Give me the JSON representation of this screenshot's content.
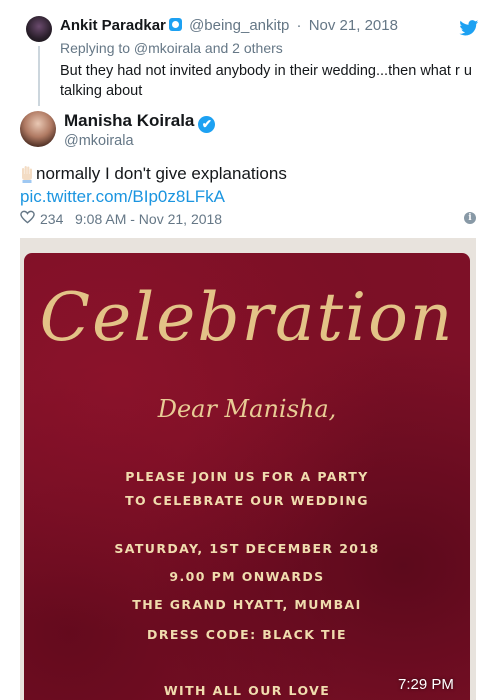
{
  "reply_tweet": {
    "name": "Ankit Paradkar",
    "handle": "@being_ankitp",
    "separator": "·",
    "date": "Nov 21, 2018",
    "replying_to": "Replying to @mkoirala and 2 others",
    "text": "But they had not invited anybody in their wedding...then what r u talking about"
  },
  "main_tweet": {
    "name": "Manisha Koirala",
    "verified_mark": "✔",
    "handle": "@mkoirala",
    "text": "normally I don't give explanations",
    "link": "pic.twitter.com/BIp0z8LFkA",
    "likes": "234",
    "timestamp": "9:08 AM - Nov 21, 2018",
    "info_glyph": "i"
  },
  "invitation": {
    "title": "Celebration",
    "salutation": "Dear Manisha,",
    "line1": "PLEASE JOIN US FOR A PARTY",
    "line2": "TO CELEBRATE OUR WEDDING",
    "line3": "SATURDAY, 1ST DECEMBER 2018",
    "line4": "9.00 PM ONWARDS",
    "line5": "THE GRAND HYATT, MUMBAI",
    "line6": "DRESS CODE: BLACK TIE",
    "line7": "WITH ALL OUR LOVE"
  },
  "status_time": "7:29 PM",
  "icons": {
    "bird": "twitter-bird-icon",
    "hand": "raised-hand-icon",
    "heart": "heart-icon",
    "info": "info-icon",
    "verified": "verified-badge-icon"
  },
  "colors": {
    "twitter_blue": "#1da1f2",
    "link": "#1b95e0",
    "muted": "#657786",
    "invite_background": "#7d1027",
    "invite_gold": "#e3c387"
  }
}
